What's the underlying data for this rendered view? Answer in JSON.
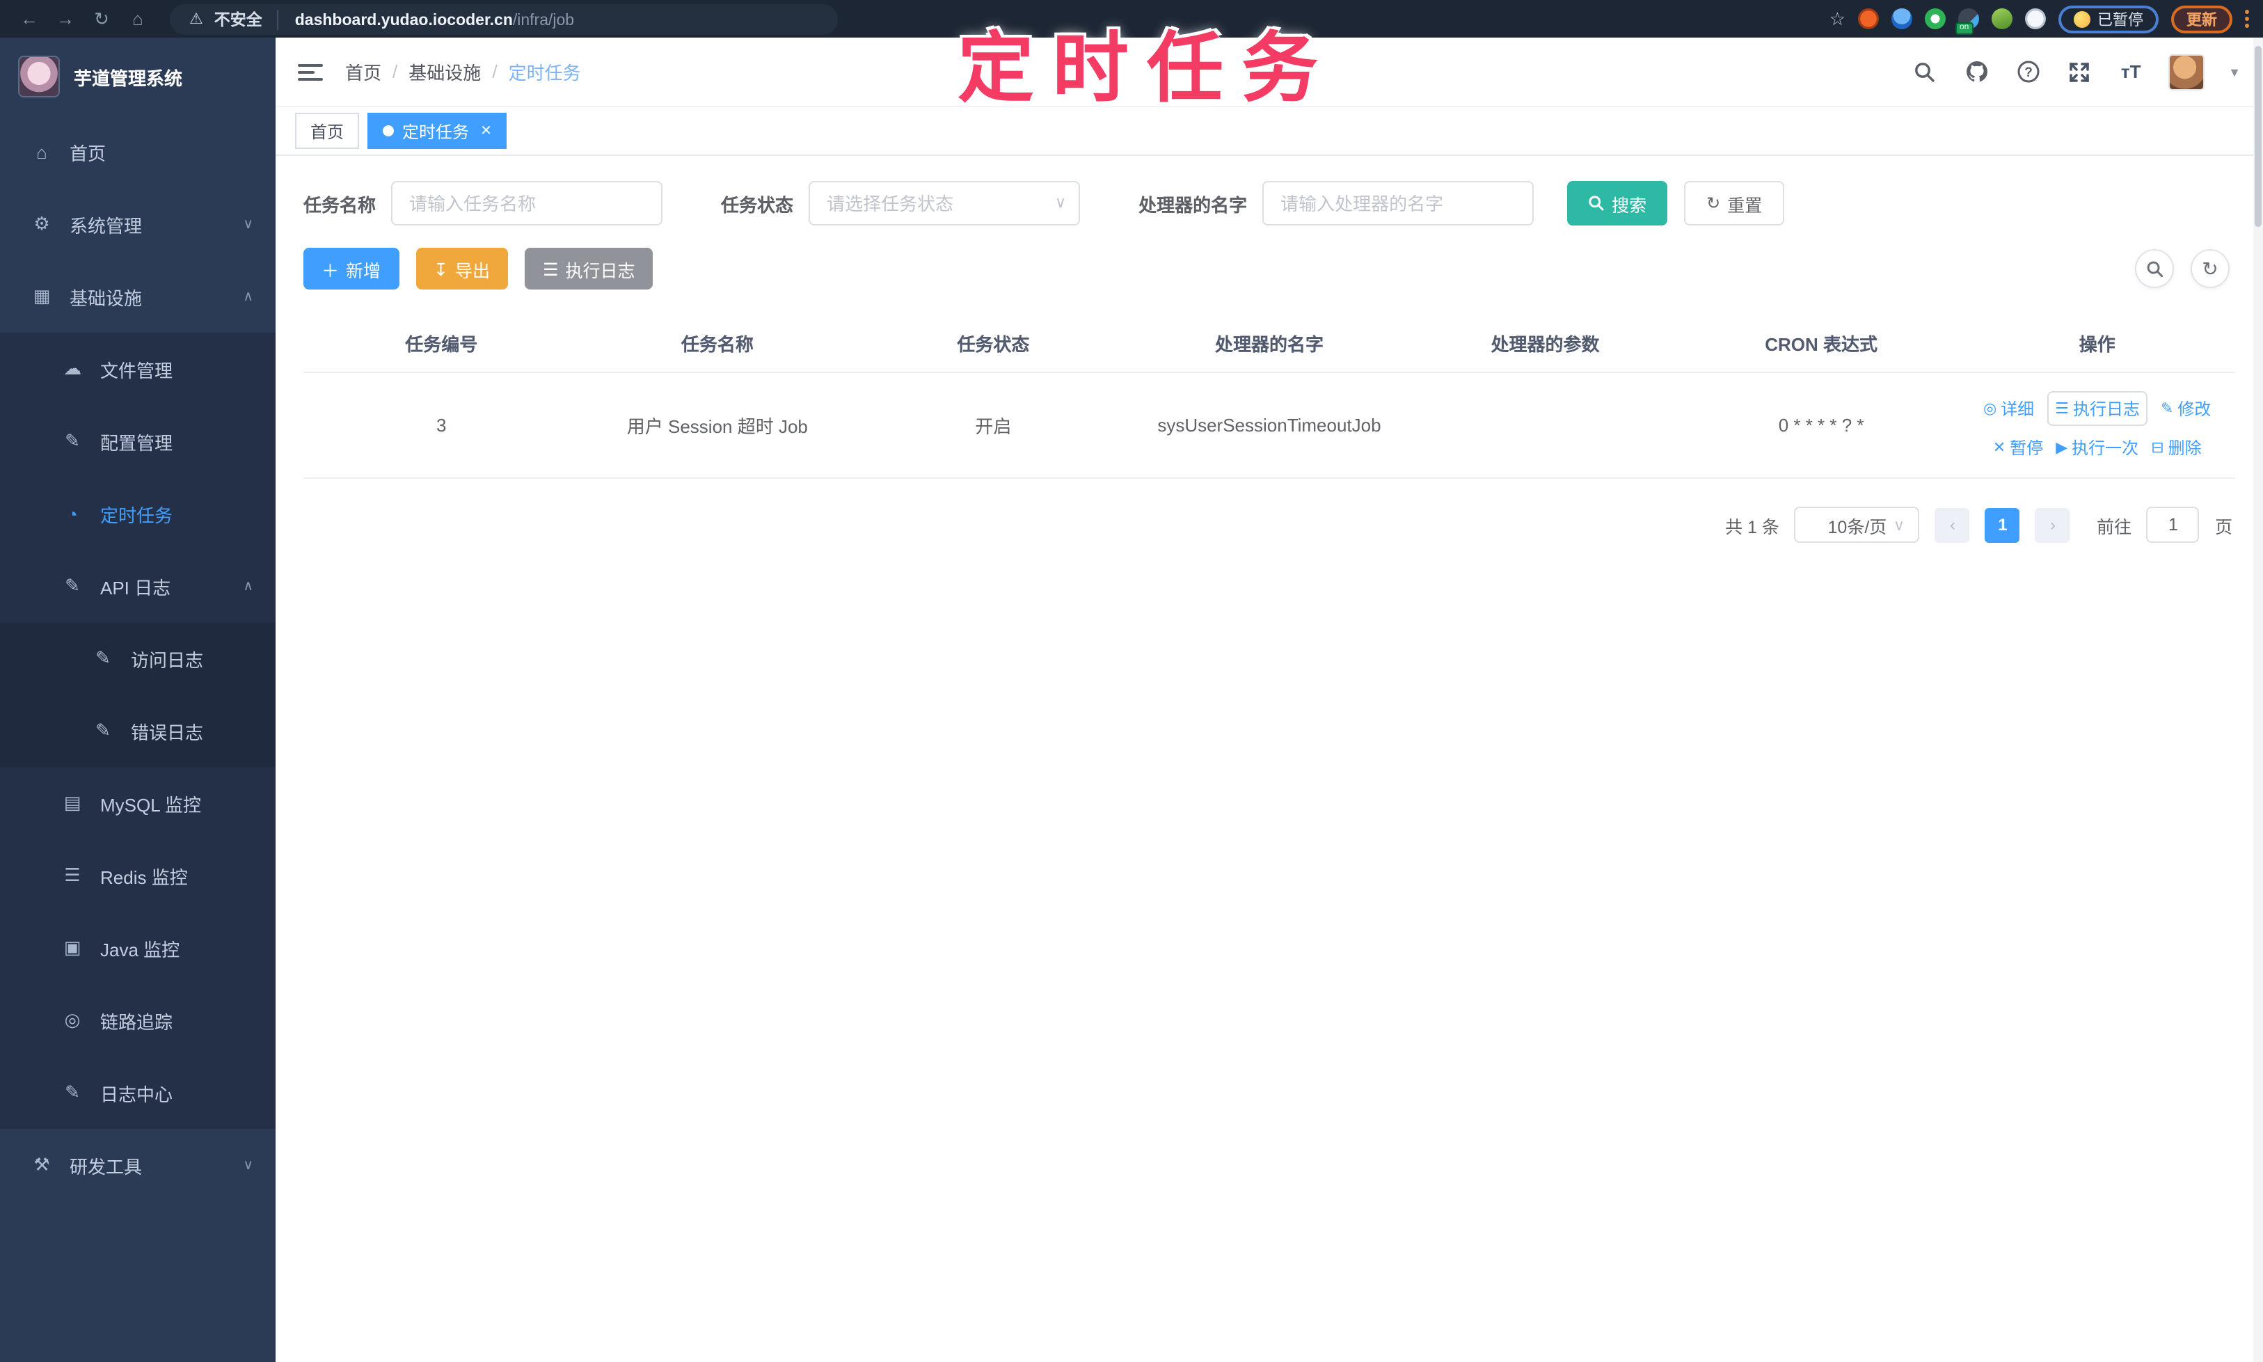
{
  "colors": {
    "accent": "#409eff",
    "search_teal": "#2eb9a4",
    "export_yellow": "#f0a73c",
    "info_gray": "#909399",
    "sidebar_bg": "#2b3a55",
    "sidebar_sub_bg": "#243048",
    "annotation_pink": "#f43b63",
    "chrome_bg": "#1d2634"
  },
  "annotation": {
    "text": "定时任务"
  },
  "browser": {
    "security_label": "不安全",
    "url_host": "dashboard.yudao.iocoder.cn",
    "url_path": "/infra/job",
    "paused_label": "已暂停",
    "update_label": "更新",
    "ext_badge": "on",
    "icons": [
      "back-icon",
      "forward-icon",
      "reload-icon",
      "home-icon",
      "warning-icon",
      "bookmark-star-icon",
      "extension-icons",
      "menu-kebab-icon"
    ]
  },
  "sidebar": {
    "title": "芋道管理系统",
    "items": [
      {
        "id": "home",
        "label": "首页",
        "glyph": "⌂",
        "icon": "home-icon",
        "depth": 0
      },
      {
        "id": "system",
        "label": "系统管理",
        "glyph": "⚙",
        "icon": "gear-icon",
        "depth": 0,
        "arrow": "down"
      },
      {
        "id": "infra",
        "label": "基础设施",
        "glyph": "▦",
        "icon": "grid-icon",
        "depth": 0,
        "arrow": "up"
      },
      {
        "id": "file",
        "label": "文件管理",
        "glyph": "☁",
        "icon": "cloud-icon",
        "depth": 1
      },
      {
        "id": "config",
        "label": "配置管理",
        "glyph": "✎",
        "icon": "edit-icon",
        "depth": 1
      },
      {
        "id": "job",
        "label": "定时任务",
        "glyph": "◔",
        "icon": "timer-icon",
        "depth": 1,
        "active": true
      },
      {
        "id": "api-log",
        "label": "API 日志",
        "glyph": "✎",
        "icon": "log-icon",
        "depth": 1,
        "arrow": "up"
      },
      {
        "id": "access-log",
        "label": "访问日志",
        "glyph": "✎",
        "icon": "access-log-icon",
        "depth": 2
      },
      {
        "id": "error-log",
        "label": "错误日志",
        "glyph": "✎",
        "icon": "error-log-icon",
        "depth": 2
      },
      {
        "id": "mysql",
        "label": "MySQL 监控",
        "glyph": "▤",
        "icon": "mysql-icon",
        "depth": 1
      },
      {
        "id": "redis",
        "label": "Redis 监控",
        "glyph": "☰",
        "icon": "redis-icon",
        "depth": 1
      },
      {
        "id": "java",
        "label": "Java 监控",
        "glyph": "▣",
        "icon": "java-monitor-icon",
        "depth": 1
      },
      {
        "id": "trace",
        "label": "链路追踪",
        "glyph": "◎",
        "icon": "trace-eye-icon",
        "depth": 1
      },
      {
        "id": "log-center",
        "label": "日志中心",
        "glyph": "✎",
        "icon": "log-center-icon",
        "depth": 1
      },
      {
        "id": "dev-tools",
        "label": "研发工具",
        "glyph": "⚒",
        "icon": "toolbox-icon",
        "depth": 0,
        "arrow": "down"
      }
    ]
  },
  "header": {
    "breadcrumb": [
      "首页",
      "基础设施",
      "定时任务"
    ],
    "icons": [
      "search-icon",
      "github-icon",
      "help-icon",
      "fullscreen-icon",
      "font-size-icon",
      "avatar",
      "caret-down-icon"
    ]
  },
  "tags": [
    {
      "label": "首页",
      "active": false,
      "closable": false
    },
    {
      "label": "定时任务",
      "active": true,
      "closable": true
    }
  ],
  "filter": {
    "name_label": "任务名称",
    "name_placeholder": "请输入任务名称",
    "status_label": "任务状态",
    "status_placeholder": "请选择任务状态",
    "handler_label": "处理器的名字",
    "handler_placeholder": "请输入处理器的名字",
    "search_label": "搜索",
    "reset_label": "重置"
  },
  "toolbar": {
    "add_label": "新增",
    "export_label": "导出",
    "exec_log_label": "执行日志"
  },
  "table": {
    "headers": [
      "任务编号",
      "任务名称",
      "任务状态",
      "处理器的名字",
      "处理器的参数",
      "CRON 表达式",
      "操作"
    ],
    "rows": [
      {
        "id": "3",
        "name": "用户 Session 超时 Job",
        "status": "开启",
        "handler": "sysUserSessionTimeoutJob",
        "param": "",
        "cron": "0 * * * * ? *",
        "actions_line1": [
          {
            "label": "详细",
            "glyph": "◎",
            "icon": "detail-eye-icon",
            "focused": false
          },
          {
            "label": "执行日志",
            "glyph": "☰",
            "icon": "exec-log-icon",
            "focused": true
          },
          {
            "label": "修改",
            "glyph": "✎",
            "icon": "edit-icon",
            "focused": false
          }
        ],
        "actions_line2": [
          {
            "label": "暂停",
            "glyph": "✕",
            "icon": "pause-icon",
            "focused": false
          },
          {
            "label": "执行一次",
            "glyph": "▶",
            "icon": "run-once-icon",
            "focused": false
          },
          {
            "label": "删除",
            "glyph": "⊟",
            "icon": "delete-icon",
            "focused": false
          }
        ]
      }
    ]
  },
  "pagination": {
    "total": "共 1 条",
    "page_size": "10条/页",
    "prev": "‹",
    "current_page": "1",
    "next": "›",
    "goto_label": "前往",
    "goto_value": "1",
    "page_suffix": "页"
  }
}
